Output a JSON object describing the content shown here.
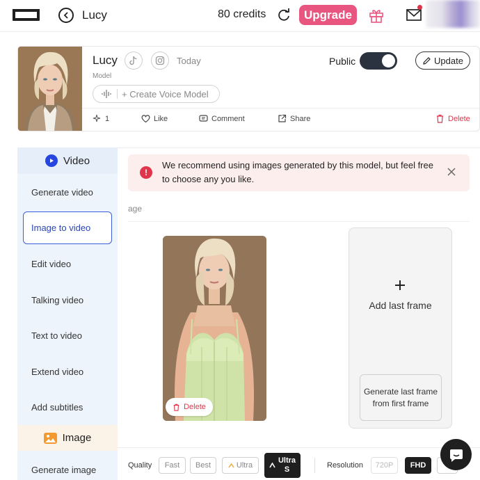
{
  "topbar": {
    "title": "Lucy",
    "credits": "80 credits",
    "upgrade_label": "Upgrade"
  },
  "model": {
    "name": "Lucy",
    "date": "Today",
    "type_label": "Model",
    "create_voice_label": "+ Create Voice Model",
    "public_label": "Public",
    "public_enabled": true,
    "update_label": "Update",
    "actions": {
      "count": "1",
      "like": "Like",
      "comment": "Comment",
      "share": "Share",
      "delete": "Delete"
    }
  },
  "sidebar": {
    "video_header": "Video",
    "video_items": [
      {
        "label": "Generate video",
        "active": false
      },
      {
        "label": "Image to video",
        "active": true
      },
      {
        "label": "Edit video",
        "active": false
      },
      {
        "label": "Talking video",
        "active": false
      },
      {
        "label": "Text to video",
        "active": false
      },
      {
        "label": "Extend video",
        "active": false
      },
      {
        "label": "Add subtitles",
        "active": false
      }
    ],
    "image_header": "Image",
    "image_items": [
      {
        "label": "Generate image",
        "active": false
      }
    ]
  },
  "main": {
    "notice_text": "We recommend using images generated by this model, but feel free to choose any you like.",
    "section_label": "age",
    "first_frame_delete": "Delete",
    "add_last_frame": "Add last frame",
    "generate_last_frame": "Generate last frame from first frame"
  },
  "toolbar": {
    "quality_label": "Quality",
    "quality_options": [
      "Fast",
      "Best",
      "Ultra",
      "Ultra S"
    ],
    "quality_selected": "Ultra S",
    "resolution_label": "Resolution",
    "resolution_options": [
      "720P",
      "FHD"
    ],
    "resolution_selected": "FHD"
  },
  "colors": {
    "accent": "#e85680",
    "sidebar_bg": "#eef4fb",
    "active_border": "#3b5dd8",
    "notice_bg": "#fdeeee",
    "danger": "#e0344a"
  }
}
